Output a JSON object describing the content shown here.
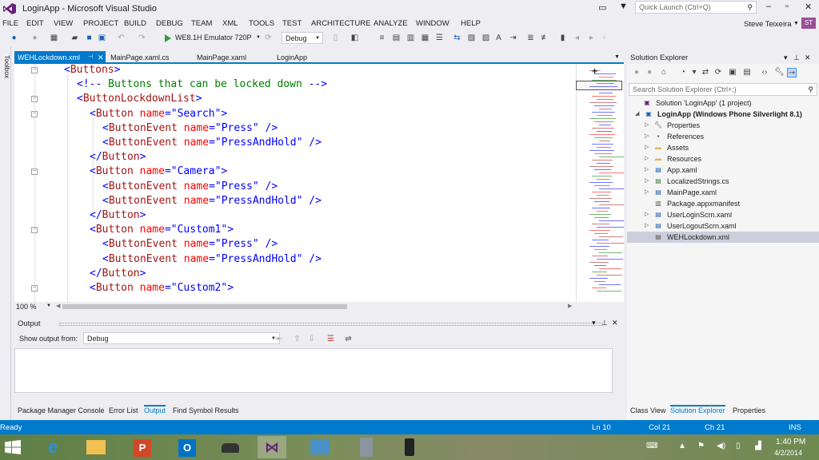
{
  "window": {
    "title": "LoginApp - Microsoft Visual Studio",
    "quick_launch_placeholder": "Quick Launch (Ctrl+Q)",
    "user_name": "Steve Teixeira",
    "user_initials": "ST"
  },
  "menu": [
    "FILE",
    "EDIT",
    "VIEW",
    "PROJECT",
    "BUILD",
    "DEBUG",
    "TEAM",
    "XML",
    "TOOLS",
    "TEST",
    "ARCHITECTURE",
    "ANALYZE",
    "WINDOW",
    "HELP"
  ],
  "toolbar": {
    "run_target": "WE8.1H Emulator 720P",
    "configuration": "Debug"
  },
  "left_strip": {
    "toolbox": "Toolbox"
  },
  "doc_tabs": [
    {
      "label": "WEHLockdown.xml",
      "active": true
    },
    {
      "label": "MainPage.xaml.cs",
      "active": false
    },
    {
      "label": "MainPage.xaml",
      "active": false
    },
    {
      "label": "LoginApp",
      "active": false
    }
  ],
  "code": [
    [
      [
        "t",
        "<"
      ],
      [
        "g",
        "Buttons"
      ],
      [
        "t",
        ">"
      ]
    ],
    [
      [
        "t",
        "<!-- "
      ],
      [
        "c",
        "Buttons that can be locked down"
      ],
      [
        "t",
        " -->"
      ]
    ],
    [
      [
        "t",
        "<"
      ],
      [
        "g",
        "ButtonLockdownList"
      ],
      [
        "t",
        ">"
      ]
    ],
    [
      [
        "t",
        "<"
      ],
      [
        "g",
        "Button"
      ],
      [
        "s",
        " "
      ],
      [
        "a",
        "name"
      ],
      [
        "t",
        "=\""
      ],
      [
        "v",
        "Search"
      ],
      [
        "t",
        "\">"
      ]
    ],
    [
      [
        "t",
        "<"
      ],
      [
        "g",
        "ButtonEvent"
      ],
      [
        "s",
        " "
      ],
      [
        "a",
        "name"
      ],
      [
        "t",
        "=\""
      ],
      [
        "v",
        "Press"
      ],
      [
        "t",
        "\" />"
      ]
    ],
    [
      [
        "t",
        "<"
      ],
      [
        "g",
        "ButtonEvent"
      ],
      [
        "s",
        " "
      ],
      [
        "a",
        "name"
      ],
      [
        "t",
        "=\""
      ],
      [
        "v",
        "PressAndHold"
      ],
      [
        "t",
        "\" />"
      ]
    ],
    [
      [
        "t",
        "</"
      ],
      [
        "g",
        "Button"
      ],
      [
        "t",
        ">"
      ]
    ],
    [
      [
        "t",
        "<"
      ],
      [
        "g",
        "Button"
      ],
      [
        "s",
        " "
      ],
      [
        "a",
        "name"
      ],
      [
        "t",
        "=\""
      ],
      [
        "v",
        "Camera"
      ],
      [
        "t",
        "\">"
      ]
    ],
    [
      [
        "t",
        "<"
      ],
      [
        "g",
        "ButtonEvent"
      ],
      [
        "s",
        " "
      ],
      [
        "a",
        "name"
      ],
      [
        "t",
        "=\""
      ],
      [
        "v",
        "Press"
      ],
      [
        "t",
        "\" />"
      ]
    ],
    [
      [
        "t",
        "<"
      ],
      [
        "g",
        "ButtonEvent"
      ],
      [
        "s",
        " "
      ],
      [
        "a",
        "name"
      ],
      [
        "t",
        "=\""
      ],
      [
        "v",
        "PressAndHold"
      ],
      [
        "t",
        "\" />"
      ]
    ],
    [
      [
        "t",
        "</"
      ],
      [
        "g",
        "Button"
      ],
      [
        "t",
        ">"
      ]
    ],
    [
      [
        "t",
        "<"
      ],
      [
        "g",
        "Button"
      ],
      [
        "s",
        " "
      ],
      [
        "a",
        "name"
      ],
      [
        "t",
        "=\""
      ],
      [
        "v",
        "Custom1"
      ],
      [
        "t",
        "\">"
      ]
    ],
    [
      [
        "t",
        "<"
      ],
      [
        "g",
        "ButtonEvent"
      ],
      [
        "s",
        " "
      ],
      [
        "a",
        "name"
      ],
      [
        "t",
        "=\""
      ],
      [
        "v",
        "Press"
      ],
      [
        "t",
        "\" />"
      ]
    ],
    [
      [
        "t",
        "<"
      ],
      [
        "g",
        "ButtonEvent"
      ],
      [
        "s",
        " "
      ],
      [
        "a",
        "name"
      ],
      [
        "t",
        "=\""
      ],
      [
        "v",
        "PressAndHold"
      ],
      [
        "t",
        "\" />"
      ]
    ],
    [
      [
        "t",
        "</"
      ],
      [
        "g",
        "Button"
      ],
      [
        "t",
        ">"
      ]
    ],
    [
      [
        "t",
        "<"
      ],
      [
        "g",
        "Button"
      ],
      [
        "s",
        " "
      ],
      [
        "a",
        "name"
      ],
      [
        "t",
        "=\""
      ],
      [
        "v",
        "Custom2"
      ],
      [
        "t",
        "\">"
      ]
    ]
  ],
  "editor": {
    "zoom": "100 %"
  },
  "output": {
    "title": "Output",
    "show_from_label": "Show output from:",
    "source": "Debug"
  },
  "bottom_tabs": [
    {
      "label": "Package Manager Console",
      "active": false
    },
    {
      "label": "Error List",
      "active": false
    },
    {
      "label": "Output",
      "active": true
    },
    {
      "label": "Find Symbol Results",
      "active": false
    }
  ],
  "solution_explorer": {
    "title": "Solution Explorer",
    "search_placeholder": "Search Solution Explorer (Ctrl+;)",
    "items": [
      {
        "label": "Solution 'LoginApp' (1 project)",
        "depth": 0,
        "arrow": "",
        "icon": "solution",
        "bold": false,
        "selected": false
      },
      {
        "label": "LoginApp (Windows Phone Silverlight 8.1)",
        "depth": 1,
        "arrow": "open",
        "icon": "project",
        "bold": true,
        "selected": false
      },
      {
        "label": "Properties",
        "depth": 2,
        "arrow": "closed",
        "icon": "wrench",
        "bold": false,
        "selected": false
      },
      {
        "label": "References",
        "depth": 2,
        "arrow": "closed",
        "icon": "references",
        "bold": false,
        "selected": false
      },
      {
        "label": "Assets",
        "depth": 2,
        "arrow": "closed",
        "icon": "folder",
        "bold": false,
        "selected": false
      },
      {
        "label": "Resources",
        "depth": 2,
        "arrow": "closed",
        "icon": "folder",
        "bold": false,
        "selected": false
      },
      {
        "label": "App.xaml",
        "depth": 2,
        "arrow": "closed",
        "icon": "xaml",
        "bold": false,
        "selected": false
      },
      {
        "label": "LocalizedStrings.cs",
        "depth": 2,
        "arrow": "closed",
        "icon": "cs",
        "bold": false,
        "selected": false
      },
      {
        "label": "MainPage.xaml",
        "depth": 2,
        "arrow": "closed",
        "icon": "xaml",
        "bold": false,
        "selected": false
      },
      {
        "label": "Package.appxmanifest",
        "depth": 2,
        "arrow": "",
        "icon": "manifest",
        "bold": false,
        "selected": false
      },
      {
        "label": "UserLoginScrn.xaml",
        "depth": 2,
        "arrow": "closed",
        "icon": "xaml",
        "bold": false,
        "selected": false
      },
      {
        "label": "UserLogoutScrn.xaml",
        "depth": 2,
        "arrow": "closed",
        "icon": "xaml",
        "bold": false,
        "selected": false
      },
      {
        "label": "WEHLockdown.xml",
        "depth": 2,
        "arrow": "",
        "icon": "xml",
        "bold": false,
        "selected": true
      }
    ],
    "bottom_tabs": [
      {
        "label": "Class View",
        "active": false
      },
      {
        "label": "Solution Explorer",
        "active": true
      },
      {
        "label": "Properties",
        "active": false
      }
    ]
  },
  "status": {
    "state": "Ready",
    "line": "Ln 10",
    "col": "Col 21",
    "ch": "Ch 21",
    "mode": "INS"
  },
  "taskbar": {
    "time": "1:40 PM",
    "date": "4/2/2014"
  },
  "colors": {
    "accent": "#007acc",
    "xml_delimiter": "#0000ff",
    "xml_tag": "#a31515",
    "xml_attribute": "#ff0000",
    "xml_comment": "#008000"
  }
}
